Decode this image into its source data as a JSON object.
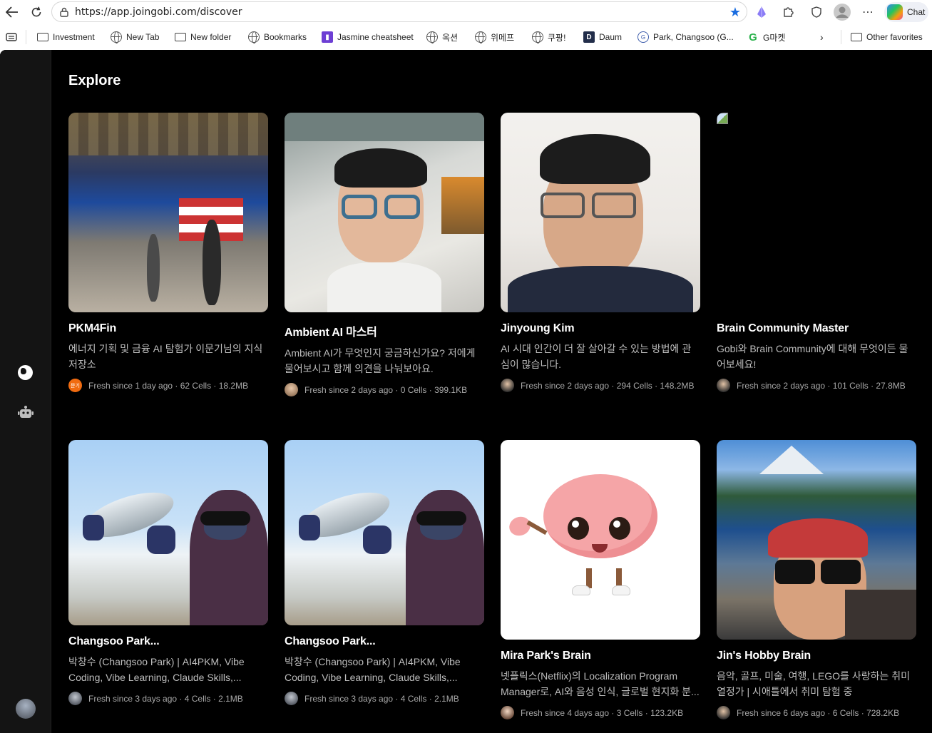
{
  "browser": {
    "url": "https://app.joingobi.com/discover",
    "chat_label": "Chat",
    "bookmarks": [
      {
        "label": "Investment",
        "icon": "folder-icon"
      },
      {
        "label": "New Tab",
        "icon": "globe-icon"
      },
      {
        "label": "New folder",
        "icon": "folder-icon"
      },
      {
        "label": "Bookmarks",
        "icon": "globe-icon"
      },
      {
        "label": "Jasmine cheatsheet",
        "icon": "purple-doc-icon"
      },
      {
        "label": "옥션",
        "icon": "globe-icon"
      },
      {
        "label": "위메프",
        "icon": "globe-icon"
      },
      {
        "label": "쿠팡!",
        "icon": "globe-icon"
      },
      {
        "label": "Daum",
        "icon": "daum-icon"
      },
      {
        "label": "Park, Changsoo (G...",
        "icon": "ge-icon"
      },
      {
        "label": "G마켓",
        "icon": "gmarket-icon"
      }
    ],
    "other_favorites": "Other favorites"
  },
  "page": {
    "title": "Explore"
  },
  "cards": [
    {
      "title": "PKM4Fin",
      "desc": "에너지 기획 및 금융 AI 탐험가 이문기님의 지식 저장소",
      "meta": "Fresh since 1 day ago · 62 Cells · 18.2MB",
      "avatar_text": "문기",
      "image": "nyse-floor-photo"
    },
    {
      "title": "Ambient AI 마스터",
      "desc": "Ambient AI가 무엇인지 궁금하신가요? 저에게 물어보시고 함께 의견을 나눠보아요.",
      "meta": "Fresh since 2 days ago · 0 Cells · 399.1KB",
      "avatar_text": "",
      "image": "man-in-car-photo"
    },
    {
      "title": "Jinyoung Kim",
      "desc": "AI 시대 인간이 더 잘 살아갈 수 있는 방법에 관심이 많습니다.",
      "meta": "Fresh since 2 days ago · 294 Cells · 148.2MB",
      "avatar_text": "",
      "image": "portrait-photo"
    },
    {
      "title": "Brain Community Master",
      "desc": "Gobi와 Brain Community에 대해 무엇이든 물어보세요!",
      "meta": "Fresh since 2 days ago · 101 Cells · 27.8MB",
      "avatar_text": "",
      "image": "broken-image"
    },
    {
      "title": "Changsoo Park...",
      "desc": "박창수 (Changsoo Park) | AI4PKM, Vibe Coding, Vibe Learning, Claude Skills,...",
      "meta": "Fresh since 3 days ago · 4 Cells · 2.1MB",
      "avatar_text": "",
      "image": "fishing-photo"
    },
    {
      "title": "Changsoo Park...",
      "desc": "박창수 (Changsoo Park) | AI4PKM, Vibe Coding, Vibe Learning, Claude Skills,...",
      "meta": "Fresh since 3 days ago · 4 Cells · 2.1MB",
      "avatar_text": "",
      "image": "fishing-photo"
    },
    {
      "title": "Mira Park's Brain",
      "desc": "넷플릭스(Netflix)의 Localization Program Manager로, AI와 음성 인식, 글로벌 현지화 분...",
      "meta": "Fresh since 4 days ago · 3 Cells · 123.2KB",
      "avatar_text": "",
      "image": "brain-mascot"
    },
    {
      "title": "Jin's Hobby Brain",
      "desc": "음악, 골프, 미술, 여행, LEGO를 사랑하는 취미 열정가 | 시애틀에서 취미 탐험 중",
      "meta": "Fresh since 6 days ago · 6 Cells · 728.2KB",
      "avatar_text": "",
      "image": "lake-selfie-photo"
    }
  ]
}
